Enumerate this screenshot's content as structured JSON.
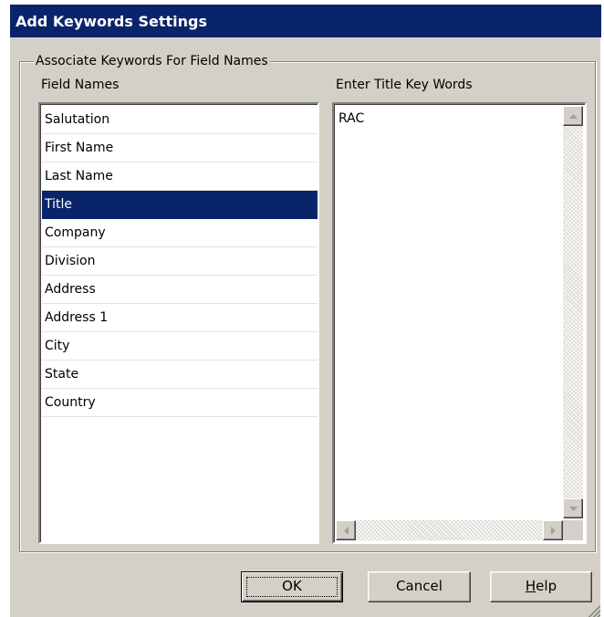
{
  "window": {
    "title": "Add Keywords Settings"
  },
  "group": {
    "legend": "Associate Keywords For Field Names",
    "field_names_label": "Field Names",
    "keywords_label": "Enter Title Key Words"
  },
  "field_names": [
    {
      "label": "Salutation",
      "selected": false
    },
    {
      "label": "First Name",
      "selected": false
    },
    {
      "label": "Last Name",
      "selected": false
    },
    {
      "label": "Title",
      "selected": true
    },
    {
      "label": "Company",
      "selected": false
    },
    {
      "label": "Division",
      "selected": false
    },
    {
      "label": "Address",
      "selected": false
    },
    {
      "label": "Address 1",
      "selected": false
    },
    {
      "label": "City",
      "selected": false
    },
    {
      "label": "State",
      "selected": false
    },
    {
      "label": "Country",
      "selected": false
    }
  ],
  "keywords": {
    "value": "RAC"
  },
  "buttons": {
    "ok": "OK",
    "cancel": "Cancel",
    "help_mnemonic": "H",
    "help_rest": "elp"
  },
  "colors": {
    "titlebar": "#0a246a",
    "face": "#d4d0c8",
    "selection": "#0a246a"
  }
}
